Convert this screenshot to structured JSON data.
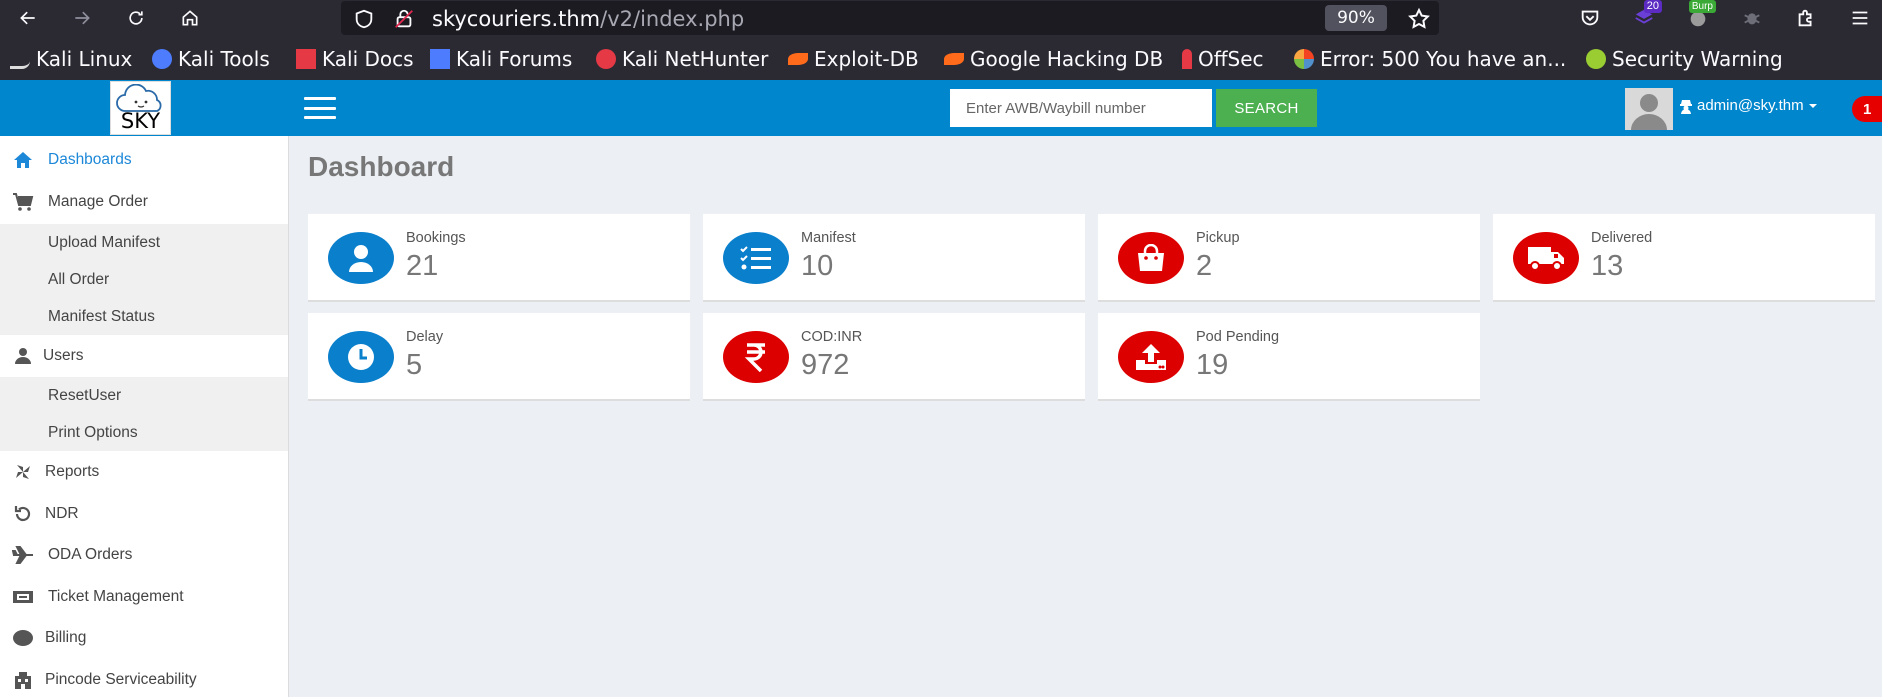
{
  "browser": {
    "url_host": "skycouriers.thm",
    "url_path": "/v2/index.php",
    "zoom": "90%",
    "badge_ublock": "20",
    "badge_burp": "Burp",
    "bookmarks": [
      {
        "label": "Kali Linux",
        "icon": "kali-dragon-icon",
        "color": "#ffffff"
      },
      {
        "label": "Kali Tools",
        "icon": "kali-tools-icon",
        "color": "#4d7cff"
      },
      {
        "label": "Kali Docs",
        "icon": "kali-docs-icon",
        "color": "#e63946"
      },
      {
        "label": "Kali Forums",
        "icon": "kali-forums-icon",
        "color": "#4d7cff"
      },
      {
        "label": "Kali NetHunter",
        "icon": "nethunter-icon",
        "color": "#e63946"
      },
      {
        "label": "Exploit-DB",
        "icon": "exploit-db-icon",
        "color": "#ff6b1a"
      },
      {
        "label": "Google Hacking DB",
        "icon": "ghdb-icon",
        "color": "#ff6b1a"
      },
      {
        "label": "OffSec",
        "icon": "offsec-icon",
        "color": "#e63946"
      },
      {
        "label": "Error: 500 You have an...",
        "icon": "joomla-icon",
        "color": "#f4a300"
      },
      {
        "label": "Security Warning",
        "icon": "security-warning-icon",
        "color": "#9acd32"
      }
    ]
  },
  "header": {
    "logo_text": "SKY",
    "search_placeholder": "Enter AWB/Waybill number",
    "search_button": "SEARCH",
    "user": "admin@sky.thm",
    "notification_count": "1"
  },
  "sidebar": {
    "dashboards": "Dashboards",
    "manage_order": "Manage Order",
    "manage_order_items": [
      "Upload Manifest",
      "All Order",
      "Manifest Status"
    ],
    "users": "Users",
    "users_items": [
      "ResetUser",
      "Print Options"
    ],
    "reports": "Reports",
    "ndr": "NDR",
    "oda_orders": "ODA Orders",
    "ticket_management": "Ticket Management",
    "billing": "Billing",
    "pincode": "Pincode Serviceability"
  },
  "main": {
    "title": "Dashboard",
    "cards": [
      {
        "label": "Bookings",
        "value": "21",
        "icon": "user-icon",
        "color": "#0a7fcc"
      },
      {
        "label": "Manifest",
        "value": "10",
        "icon": "list-check-icon",
        "color": "#0a7fcc"
      },
      {
        "label": "Pickup",
        "value": "2",
        "icon": "shopping-bag-icon",
        "color": "#dd0000"
      },
      {
        "label": "Delivered",
        "value": "13",
        "icon": "truck-icon",
        "color": "#dd0000"
      },
      {
        "label": "Delay",
        "value": "5",
        "icon": "clock-icon",
        "color": "#0a7fcc"
      },
      {
        "label": "COD:INR",
        "value": "972",
        "icon": "rupee-icon",
        "color": "#dd0000"
      },
      {
        "label": "Pod Pending",
        "value": "19",
        "icon": "upload-tray-icon",
        "color": "#dd0000"
      }
    ]
  }
}
